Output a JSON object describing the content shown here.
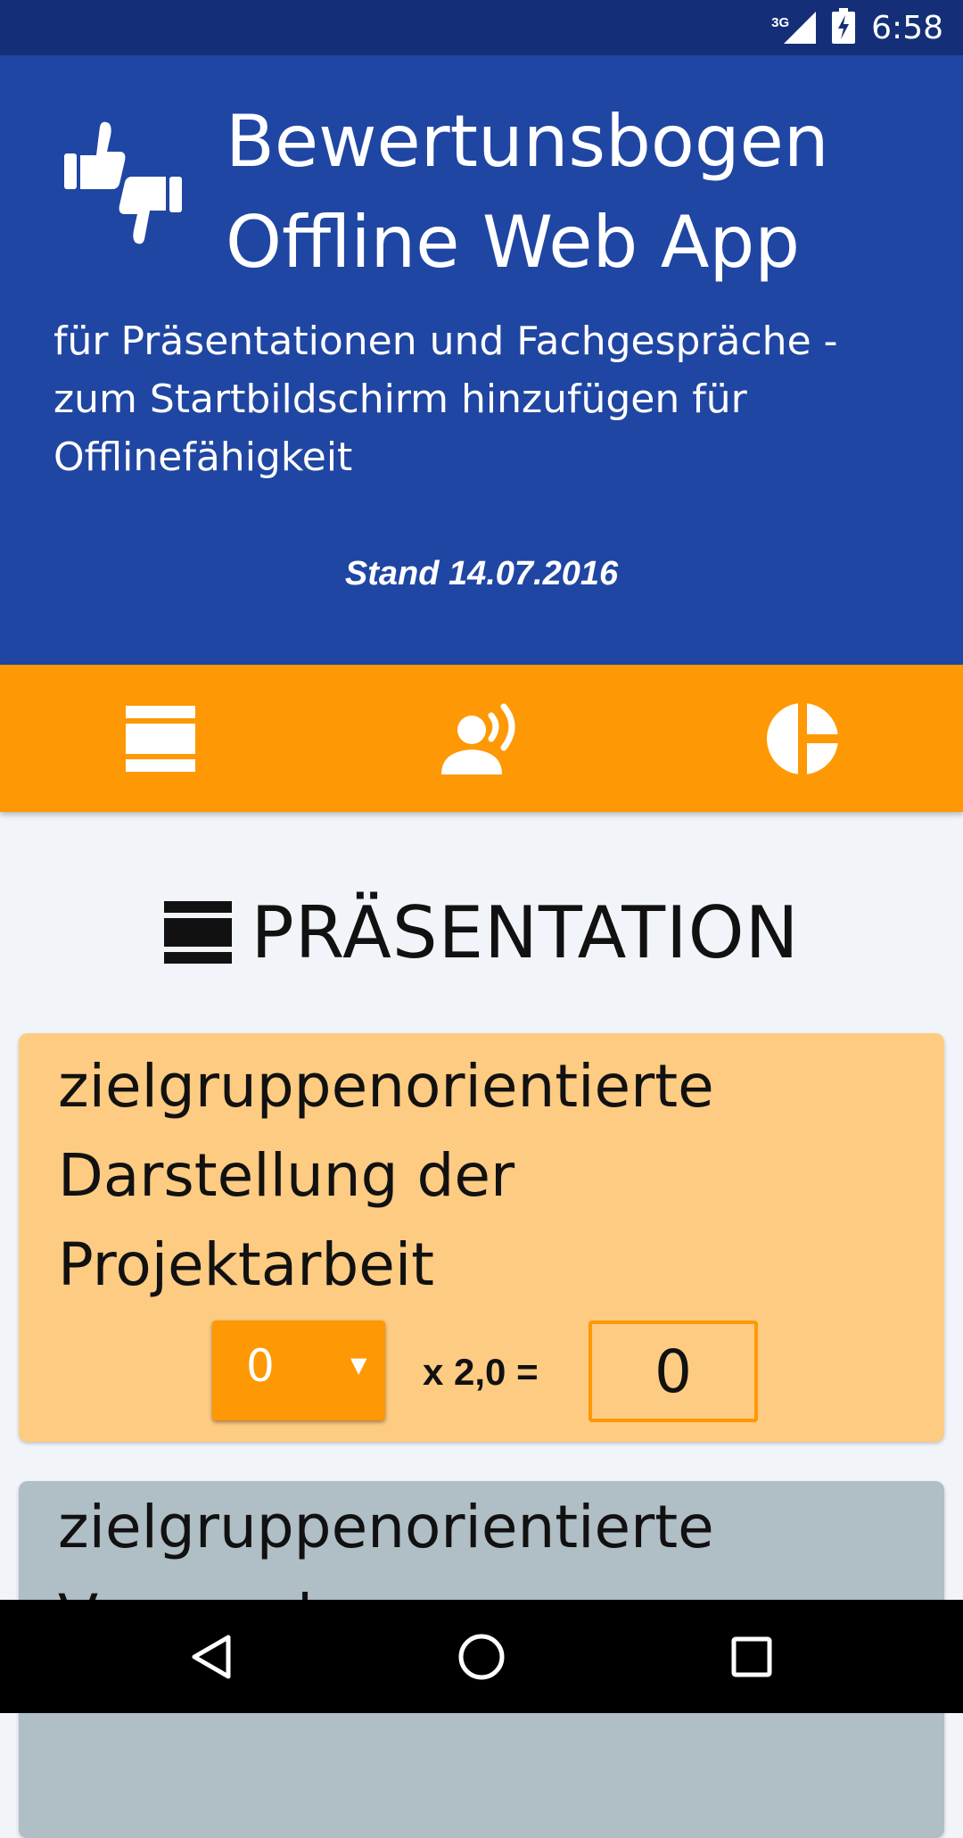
{
  "status_bar": {
    "network_type": "3G",
    "time": "6:58",
    "icons": [
      "signal-icon",
      "battery-charging-icon"
    ]
  },
  "header": {
    "logo_icon": "thumbs-up-down-icon",
    "title_line1": "Bewertunsbogen",
    "title_line2": "Offline Web App",
    "subtitle_line1": "für Präsentationen und Fachgespräche -",
    "subtitle_line2": "zum Startbildschirm hinzufügen für",
    "subtitle_line3": "Offlinefähigkeit",
    "version": "Stand 14.07.2016"
  },
  "tabs": [
    {
      "id": "praesentation",
      "icon": "presentation-icon"
    },
    {
      "id": "fachgespraech",
      "icon": "speaking-person-icon"
    },
    {
      "id": "ergebnis",
      "icon": "pie-chart-icon"
    }
  ],
  "section": {
    "icon": "presentation-icon",
    "title": "PRÄSENTATION"
  },
  "criteria": [
    {
      "title_line1": "zielgruppenorientierte",
      "title_line2": "Darstellung der",
      "title_line3": "Projektarbeit",
      "score": "0",
      "factor": "x 2,0 =",
      "result": "0"
    },
    {
      "title_line1": "zielgruppenorientierte",
      "title_line2": "Verwendung"
    }
  ],
  "colors": {
    "status_bar": "#142f77",
    "header": "#2046a3",
    "accent": "#fe9804",
    "card_active": "#fecb82",
    "card_inactive": "#b0bec5",
    "background": "#f1f4f8"
  },
  "nav_bar": {
    "icons": [
      "back-icon",
      "home-icon",
      "recents-icon"
    ]
  }
}
